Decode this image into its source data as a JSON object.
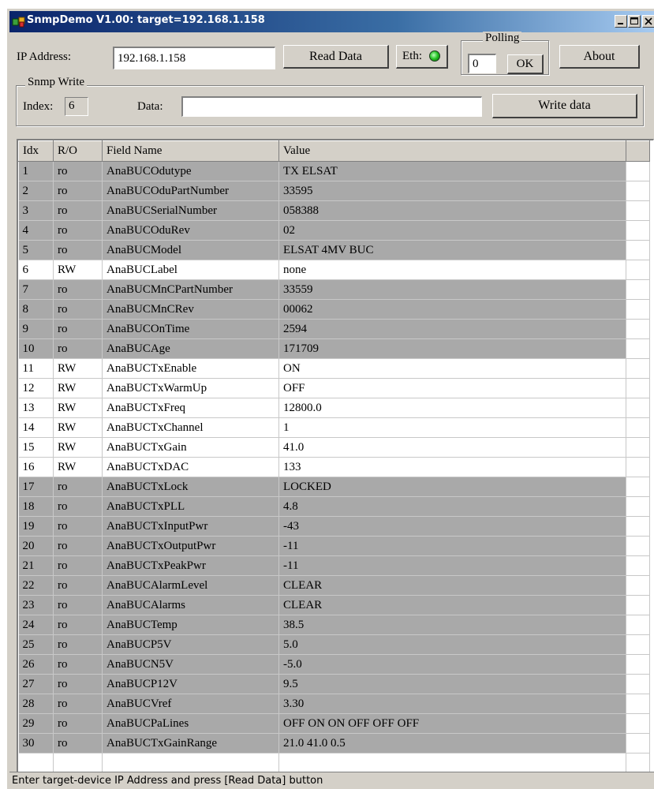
{
  "window": {
    "title": "SnmpDemo V1.00: target=192.168.1.158"
  },
  "controls": {
    "ip_label": "IP Address:",
    "ip_value": "192.168.1.158",
    "read_button": "Read Data",
    "eth_label": "Eth:",
    "eth_status_color": "#22c022",
    "polling_legend": "Polling",
    "polling_value": "0",
    "ok_button": "OK",
    "about_button": "About"
  },
  "snmp_write": {
    "legend": "Snmp Write",
    "index_label": "Index:",
    "index_value": "6",
    "data_label": "Data:",
    "data_value": "",
    "write_button": "Write data"
  },
  "table": {
    "columns": [
      "Idx",
      "R/O",
      "Field Name",
      "Value"
    ],
    "rows": [
      {
        "idx": "1",
        "ro": "ro",
        "field": "AnaBUCOdutype",
        "value": "TX ELSAT"
      },
      {
        "idx": "2",
        "ro": "ro",
        "field": "AnaBUCOduPartNumber",
        "value": "33595"
      },
      {
        "idx": "3",
        "ro": "ro",
        "field": "AnaBUCSerialNumber",
        "value": "058388"
      },
      {
        "idx": "4",
        "ro": "ro",
        "field": "AnaBUCOduRev",
        "value": "02"
      },
      {
        "idx": "5",
        "ro": "ro",
        "field": "AnaBUCModel",
        "value": "ELSAT 4MV BUC"
      },
      {
        "idx": "6",
        "ro": "RW",
        "field": "AnaBUCLabel",
        "value": "none"
      },
      {
        "idx": "7",
        "ro": "ro",
        "field": "AnaBUCMnCPartNumber",
        "value": "33559"
      },
      {
        "idx": "8",
        "ro": "ro",
        "field": "AnaBUCMnCRev",
        "value": "00062"
      },
      {
        "idx": "9",
        "ro": "ro",
        "field": "AnaBUCOnTime",
        "value": "2594"
      },
      {
        "idx": "10",
        "ro": "ro",
        "field": "AnaBUCAge",
        "value": "171709"
      },
      {
        "idx": "11",
        "ro": "RW",
        "field": "AnaBUCTxEnable",
        "value": "ON"
      },
      {
        "idx": "12",
        "ro": "RW",
        "field": "AnaBUCTxWarmUp",
        "value": "OFF"
      },
      {
        "idx": "13",
        "ro": "RW",
        "field": "AnaBUCTxFreq",
        "value": "12800.0"
      },
      {
        "idx": "14",
        "ro": "RW",
        "field": "AnaBUCTxChannel",
        "value": "1"
      },
      {
        "idx": "15",
        "ro": "RW",
        "field": "AnaBUCTxGain",
        "value": "41.0"
      },
      {
        "idx": "16",
        "ro": "RW",
        "field": "AnaBUCTxDAC",
        "value": "133"
      },
      {
        "idx": "17",
        "ro": "ro",
        "field": "AnaBUCTxLock",
        "value": "LOCKED"
      },
      {
        "idx": "18",
        "ro": "ro",
        "field": "AnaBUCTxPLL",
        "value": "4.8"
      },
      {
        "idx": "19",
        "ro": "ro",
        "field": "AnaBUCTxInputPwr",
        "value": "-43"
      },
      {
        "idx": "20",
        "ro": "ro",
        "field": "AnaBUCTxOutputPwr",
        "value": "-11"
      },
      {
        "idx": "21",
        "ro": "ro",
        "field": "AnaBUCTxPeakPwr",
        "value": "-11"
      },
      {
        "idx": "22",
        "ro": "ro",
        "field": "AnaBUCAlarmLevel",
        "value": "CLEAR"
      },
      {
        "idx": "23",
        "ro": "ro",
        "field": "AnaBUCAlarms",
        "value": "CLEAR"
      },
      {
        "idx": "24",
        "ro": "ro",
        "field": "AnaBUCTemp",
        "value": "38.5"
      },
      {
        "idx": "25",
        "ro": "ro",
        "field": "AnaBUCP5V",
        "value": "5.0"
      },
      {
        "idx": "26",
        "ro": "ro",
        "field": "AnaBUCN5V",
        "value": "-5.0"
      },
      {
        "idx": "27",
        "ro": "ro",
        "field": "AnaBUCP12V",
        "value": "9.5"
      },
      {
        "idx": "28",
        "ro": "ro",
        "field": "AnaBUCVref",
        "value": "3.30"
      },
      {
        "idx": "29",
        "ro": "ro",
        "field": "AnaBUCPaLines",
        "value": "OFF ON ON OFF OFF OFF"
      },
      {
        "idx": "30",
        "ro": "ro",
        "field": "AnaBUCTxGainRange",
        "value": "21.0 41.0 0.5"
      }
    ]
  },
  "status_bar": {
    "text": "Enter target-device IP Address and press [Read Data] button"
  }
}
